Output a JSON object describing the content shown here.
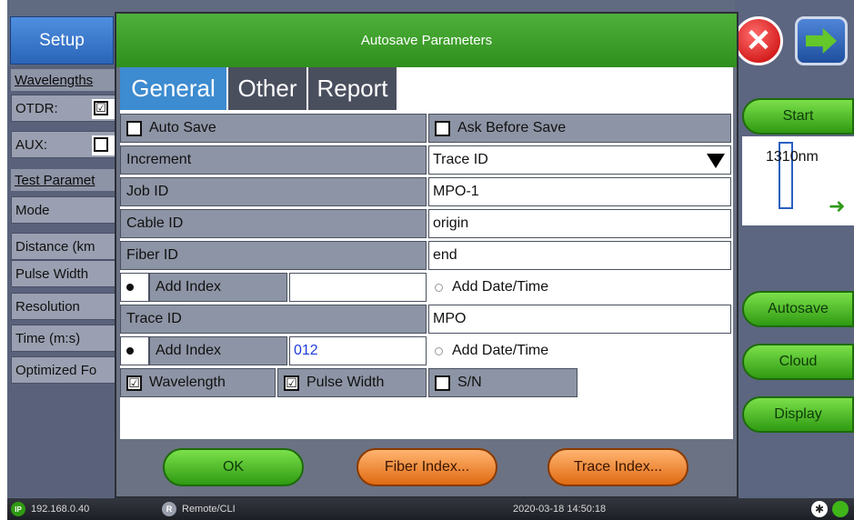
{
  "background_app": {
    "setup_tab": "Setup",
    "left_panel": {
      "wavelengths_header": "Wavelengths",
      "otdr_label": "OTDR:",
      "otdr_checked": true,
      "aux_label": "AUX:",
      "aux_checked": false,
      "test_params_header": "Test Paramet",
      "rows": [
        "Mode",
        "Distance (km",
        "Pulse Width",
        "Resolution",
        "Time (m:s)",
        "Optimized Fo"
      ]
    },
    "right_panel": {
      "start": "Start",
      "wavelength": "1310nm",
      "autosave": "Autosave",
      "cloud": "Cloud",
      "display": "Display"
    }
  },
  "dialog": {
    "title": "Autosave Parameters",
    "tabs": [
      {
        "label": "General",
        "active": true
      },
      {
        "label": "Other",
        "active": false
      },
      {
        "label": "Report",
        "active": false
      }
    ],
    "auto_save": {
      "label": "Auto Save",
      "checked": false
    },
    "ask_before_save": {
      "label": "Ask Before Save",
      "checked": false
    },
    "increment": {
      "label": "Increment",
      "value": "Trace ID"
    },
    "job_id": {
      "label": "Job ID",
      "value": "MPO-1"
    },
    "cable_id": {
      "label": "Cable ID",
      "value": "origin"
    },
    "fiber_id": {
      "label": "Fiber ID",
      "value": "end"
    },
    "fiber_add_index": {
      "label": "Add Index",
      "value": "",
      "selected": true
    },
    "fiber_add_datetime": {
      "label": "Add Date/Time",
      "selected": false
    },
    "trace_id": {
      "label": "Trace ID",
      "value": "MPO"
    },
    "trace_add_index": {
      "label": "Add Index",
      "value": "012",
      "selected": true
    },
    "trace_add_datetime": {
      "label": "Add Date/Time",
      "selected": false
    },
    "wavelength": {
      "label": "Wavelength",
      "checked": true
    },
    "pulse_width": {
      "label": "Pulse Width",
      "checked": true
    },
    "sn": {
      "label": "S/N",
      "checked": false
    },
    "buttons": {
      "ok": "OK",
      "fiber_index": "Fiber Index...",
      "trace_index": "Trace Index..."
    }
  },
  "status_bar": {
    "ip_icon": "IP",
    "ip": "192.168.0.40",
    "remote_icon": "R",
    "remote": "Remote/CLI",
    "datetime": "2020-03-18  14:50:18"
  },
  "icons": {
    "close": "close-icon",
    "next": "arrow-right-icon",
    "dropdown": "triangle-down-icon",
    "check_mark": "☑",
    "settings": "✱"
  }
}
